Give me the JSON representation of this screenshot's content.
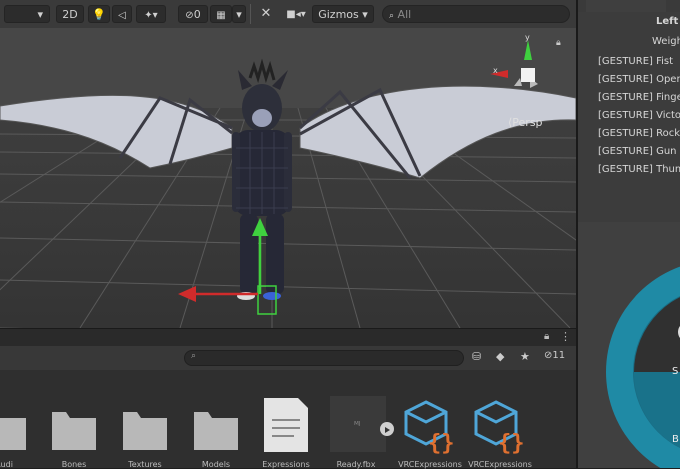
{
  "toolbar": {
    "mode_2d": "2D",
    "stats_count": "0",
    "gizmos_label": "Gizmos",
    "search_prefix": "All"
  },
  "scene": {
    "persp_label": "Persp",
    "gizmo_y_label": "y",
    "gizmo_x_label": "x"
  },
  "project": {
    "hidden_count": "11",
    "assets": [
      {
        "label": "Audi",
        "icon": "folder-icon"
      },
      {
        "label": "Bones",
        "icon": "folder-icon"
      },
      {
        "label": "Textures",
        "icon": "folder-icon"
      },
      {
        "label": "Models",
        "icon": "folder-icon"
      },
      {
        "label": "Expressions",
        "icon": "document-icon"
      },
      {
        "label": "Ready.fbx",
        "icon": "model-icon"
      },
      {
        "label": "VRCExpressions",
        "icon": "expressions-asset-icon"
      },
      {
        "label": "VRCExpressions",
        "icon": "expressions-asset-icon"
      }
    ]
  },
  "inspector": {
    "header_left": "Left",
    "header_weight": "Weight",
    "gestures": [
      "[GESTURE] Fist",
      "[GESTURE] Open",
      "[GESTURE] Fingerpoint",
      "[GESTURE] Victory",
      "[GESTURE] RockNRoll",
      "[GESTURE] Gun",
      "[GESTURE] Thumbs up"
    ],
    "wheel_letters": [
      "S",
      "B"
    ]
  },
  "colors": {
    "accent_teal": "#1f8aa5",
    "gizmo_red": "#d02b2b",
    "gizmo_green": "#3fd13f",
    "asset_blue": "#4fa6d8",
    "asset_orange": "#e07030"
  }
}
